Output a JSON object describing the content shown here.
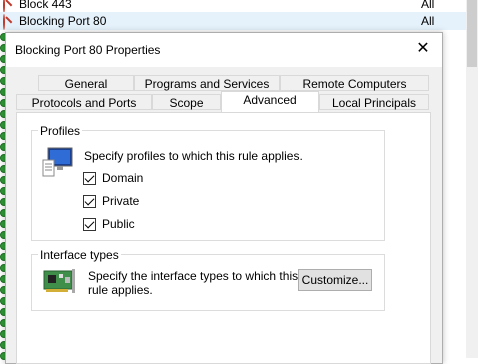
{
  "background_list": {
    "rows": [
      {
        "name": "Block 443",
        "profile": "All"
      },
      {
        "name": "Blocking Port 80",
        "profile": "All"
      }
    ]
  },
  "dialog": {
    "title": "Blocking Port 80 Properties",
    "tabs_row1": [
      "General",
      "Programs and Services",
      "Remote Computers"
    ],
    "tabs_row2": [
      "Protocols and Ports",
      "Scope",
      "Advanced",
      "Local Principals"
    ],
    "active_tab": "Advanced",
    "profiles": {
      "label": "Profiles",
      "description": "Specify profiles to which this rule applies.",
      "options": [
        {
          "label": "Domain",
          "checked": true
        },
        {
          "label": "Private",
          "checked": true
        },
        {
          "label": "Public",
          "checked": true
        }
      ]
    },
    "interface_types": {
      "label": "Interface types",
      "description_line1": "Specify the interface types to which this",
      "description_line2": "rule applies.",
      "customize_label": "Customize..."
    }
  }
}
